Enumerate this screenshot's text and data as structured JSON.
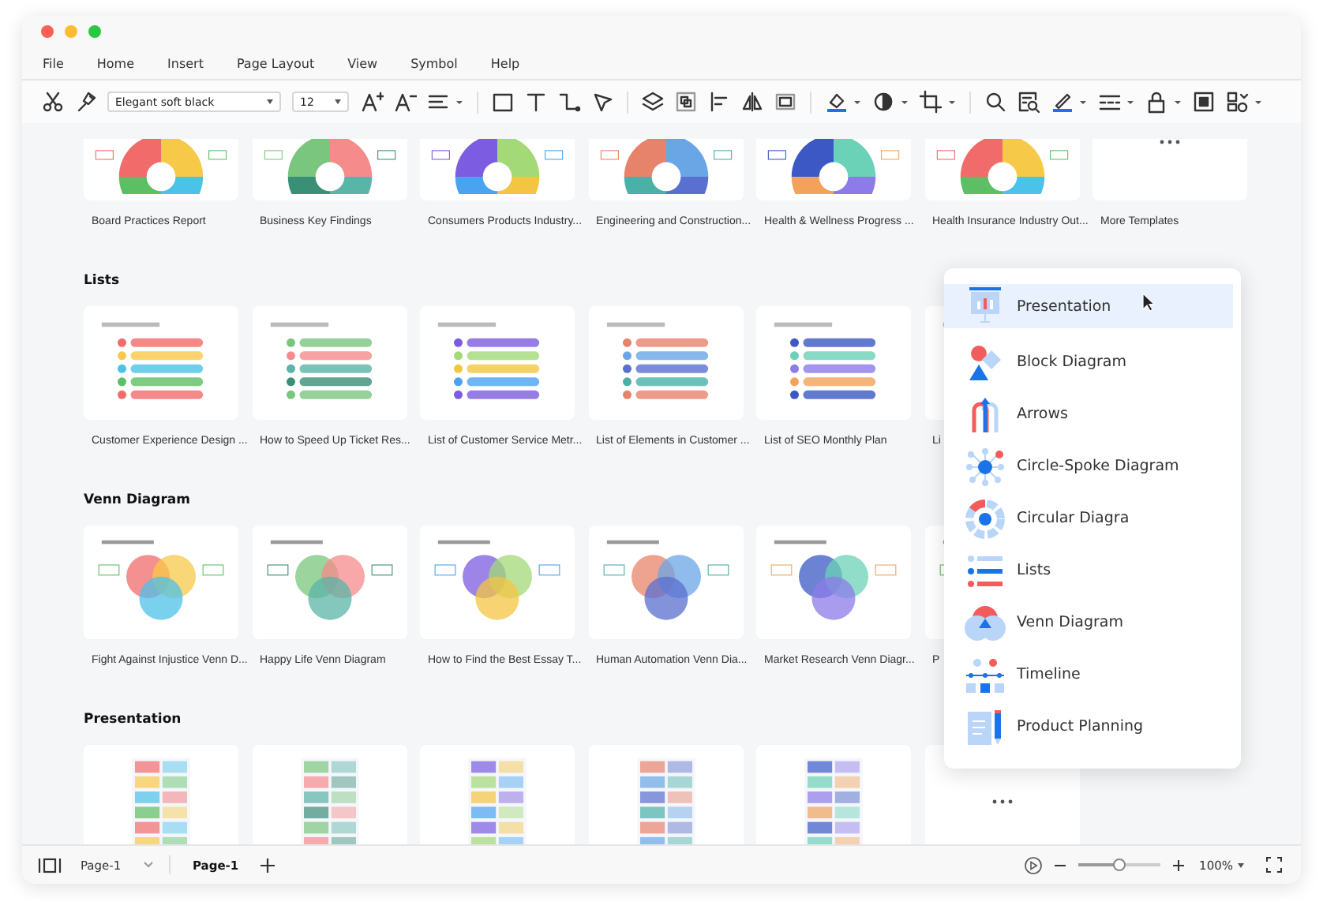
{
  "menu_bar": [
    "File",
    "Home",
    "Insert",
    "Page Layout",
    "View",
    "Symbol",
    "Help"
  ],
  "toolbar": {
    "font_name": "Elegant soft black",
    "font_size": "12"
  },
  "gallery": {
    "sections": [
      {
        "cards": [
          {
            "kind": "template",
            "label": "Board Practices Report"
          },
          {
            "kind": "template",
            "label": "Business Key Findings"
          },
          {
            "kind": "template",
            "label": "Consumers Products Industry..."
          },
          {
            "kind": "template",
            "label": "Engineering and Construction..."
          },
          {
            "kind": "template",
            "label": "Health & Wellness Progress ..."
          },
          {
            "kind": "template",
            "label": "Health Insurance Industry Out..."
          },
          {
            "kind": "more",
            "label": "More Templates"
          }
        ]
      },
      {
        "title": "Lists",
        "cards": [
          {
            "kind": "template",
            "label": "Customer Experience Design ..."
          },
          {
            "kind": "template",
            "label": "How to Speed Up Ticket Res..."
          },
          {
            "kind": "template",
            "label": "List of Customer Service Metr..."
          },
          {
            "kind": "template",
            "label": "List of Elements in Customer ..."
          },
          {
            "kind": "template",
            "label": "List of SEO Monthly Plan"
          },
          {
            "kind": "template",
            "label": "Li"
          }
        ]
      },
      {
        "title": "Venn Diagram",
        "cards": [
          {
            "kind": "template",
            "label": "Fight Against Injustice Venn D..."
          },
          {
            "kind": "template",
            "label": "Happy Life Venn Diagram"
          },
          {
            "kind": "template",
            "label": "How to Find the Best Essay T..."
          },
          {
            "kind": "template",
            "label": "Human Automation Venn Dia..."
          },
          {
            "kind": "template",
            "label": "Market Research Venn Diagr..."
          },
          {
            "kind": "template",
            "label": "P"
          }
        ]
      },
      {
        "title": "Presentation",
        "cards": [
          {
            "kind": "template"
          },
          {
            "kind": "template"
          },
          {
            "kind": "template"
          },
          {
            "kind": "template"
          },
          {
            "kind": "template"
          },
          {
            "kind": "more"
          }
        ]
      }
    ]
  },
  "category_menu": {
    "items": [
      {
        "label": "Presentation",
        "selected": true
      },
      {
        "label": "Block Diagram",
        "selected": false
      },
      {
        "label": "Arrows",
        "selected": false
      },
      {
        "label": "Circle-Spoke Diagram",
        "selected": false
      },
      {
        "label": "Circular Diagra",
        "selected": false
      },
      {
        "label": "Lists",
        "selected": false
      },
      {
        "label": "Venn Diagram",
        "selected": false
      },
      {
        "label": "Timeline",
        "selected": false
      },
      {
        "label": "Product Planning",
        "selected": false
      }
    ]
  },
  "status_bar": {
    "page_dropdown": "Page-1",
    "pages": [
      {
        "label": "Page-1",
        "selected": true
      }
    ],
    "zoom": {
      "level": 0.5,
      "reading": "100%"
    }
  }
}
